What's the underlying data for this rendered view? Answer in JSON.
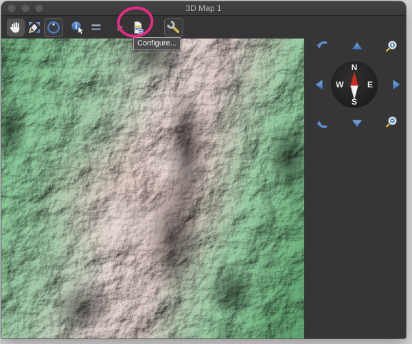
{
  "window": {
    "title": "3D Map 1"
  },
  "titlebar": {
    "traffic_lights": [
      "close",
      "minimize",
      "zoom"
    ]
  },
  "toolbar": {
    "tooltip": "Configure...",
    "tools": [
      {
        "name": "pan-tool",
        "icon": "hand-icon",
        "state": "selected"
      },
      {
        "name": "zoom-extents-tool",
        "icon": "zoom-extents-icon",
        "state": "normal"
      },
      {
        "name": "trackball-tool",
        "icon": "trackball-icon",
        "state": "outlined"
      },
      {
        "name": "info-tool",
        "icon": "info-cursor-icon",
        "state": "normal"
      },
      {
        "name": "section-tool",
        "icon": "layer-bars-icon",
        "state": "normal"
      },
      {
        "name": "play-button",
        "icon": "play-icon",
        "state": "disabled"
      },
      {
        "name": "export-tool",
        "icon": "document-export-icon",
        "state": "normal"
      },
      {
        "name": "configure-tool",
        "icon": "wrench-icon",
        "state": "outlined-highlighted"
      }
    ]
  },
  "annotation": {
    "shape": "ellipse",
    "color": "#e62a84",
    "target": "configure-tool"
  },
  "map": {
    "type": "3d-shaded-relief-terrain"
  },
  "navigation": {
    "compass": {
      "north": "N",
      "east": "E",
      "south": "S",
      "west": "W",
      "needle_color": "#d42a1e"
    },
    "controls": [
      "rotate-ccw",
      "tilt-up",
      "zoom-in",
      "pan-left",
      "compass",
      "pan-right",
      "rotate-cw",
      "tilt-down",
      "zoom-out"
    ]
  },
  "colors": {
    "window_bg": "#353535",
    "accent_blue": "#5d8fcd",
    "annotation_pink": "#e62a84",
    "needle_red": "#d42a1e",
    "wrench_gold": "#d9b64a"
  }
}
